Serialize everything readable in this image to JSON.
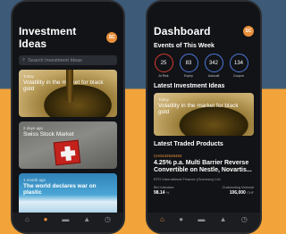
{
  "left_screen": {
    "title": "Investment Ideas",
    "badge": "SC",
    "search_placeholder": "Search Investment Ideas",
    "cards": [
      {
        "meta": "Today",
        "title": "Volatility in the market for black gold"
      },
      {
        "meta": "2 days ago",
        "title": "Swiss Stock Market"
      },
      {
        "meta": "1 month ago",
        "title": "The world declares war on plastic"
      }
    ]
  },
  "right_screen": {
    "title": "Dashboard",
    "badge": "SC",
    "events_heading": "Events of This Week",
    "events": [
      {
        "count": "25",
        "label": "At Risk",
        "color": "#d53b32"
      },
      {
        "count": "83",
        "label": "Expiry",
        "color": "#4f7ae0"
      },
      {
        "count": "342",
        "label": "Autocall",
        "color": "#4f7ae0"
      },
      {
        "count": "134",
        "label": "Coupon",
        "color": "#4f7ae0"
      }
    ],
    "latest_ideas_heading": "Latest Investment Ideas",
    "latest_idea": {
      "meta": "Today",
      "title": "Volatility in the market for black gold"
    },
    "traded_heading": "Latest Traded Products",
    "product": {
      "code": "CH0432549494",
      "title": "4.25% p.a. Multi Barrier Reverse Convertible on Nestle, Novartis...",
      "issuer": "EFG International Finance (Guernsey) Ltd.",
      "left_label": "Bid Indicative",
      "right_label": "Outstanding Notional",
      "left_value": "98.14",
      "left_unit": "%",
      "right_value": "106,000",
      "right_unit": "CHF"
    }
  },
  "tabs": [
    {
      "icon": "home-icon",
      "glyph": "⌂"
    },
    {
      "icon": "lightbulb-icon",
      "glyph": "●"
    },
    {
      "icon": "portfolio-icon",
      "glyph": "▬"
    },
    {
      "icon": "bell-icon",
      "glyph": "▲"
    },
    {
      "icon": "clock-icon",
      "glyph": "◷"
    }
  ],
  "colors": {
    "accent": "#e88f3b",
    "background_top": "#3d5b78",
    "background_bottom": "#f2a33a",
    "phone": "#111316"
  }
}
